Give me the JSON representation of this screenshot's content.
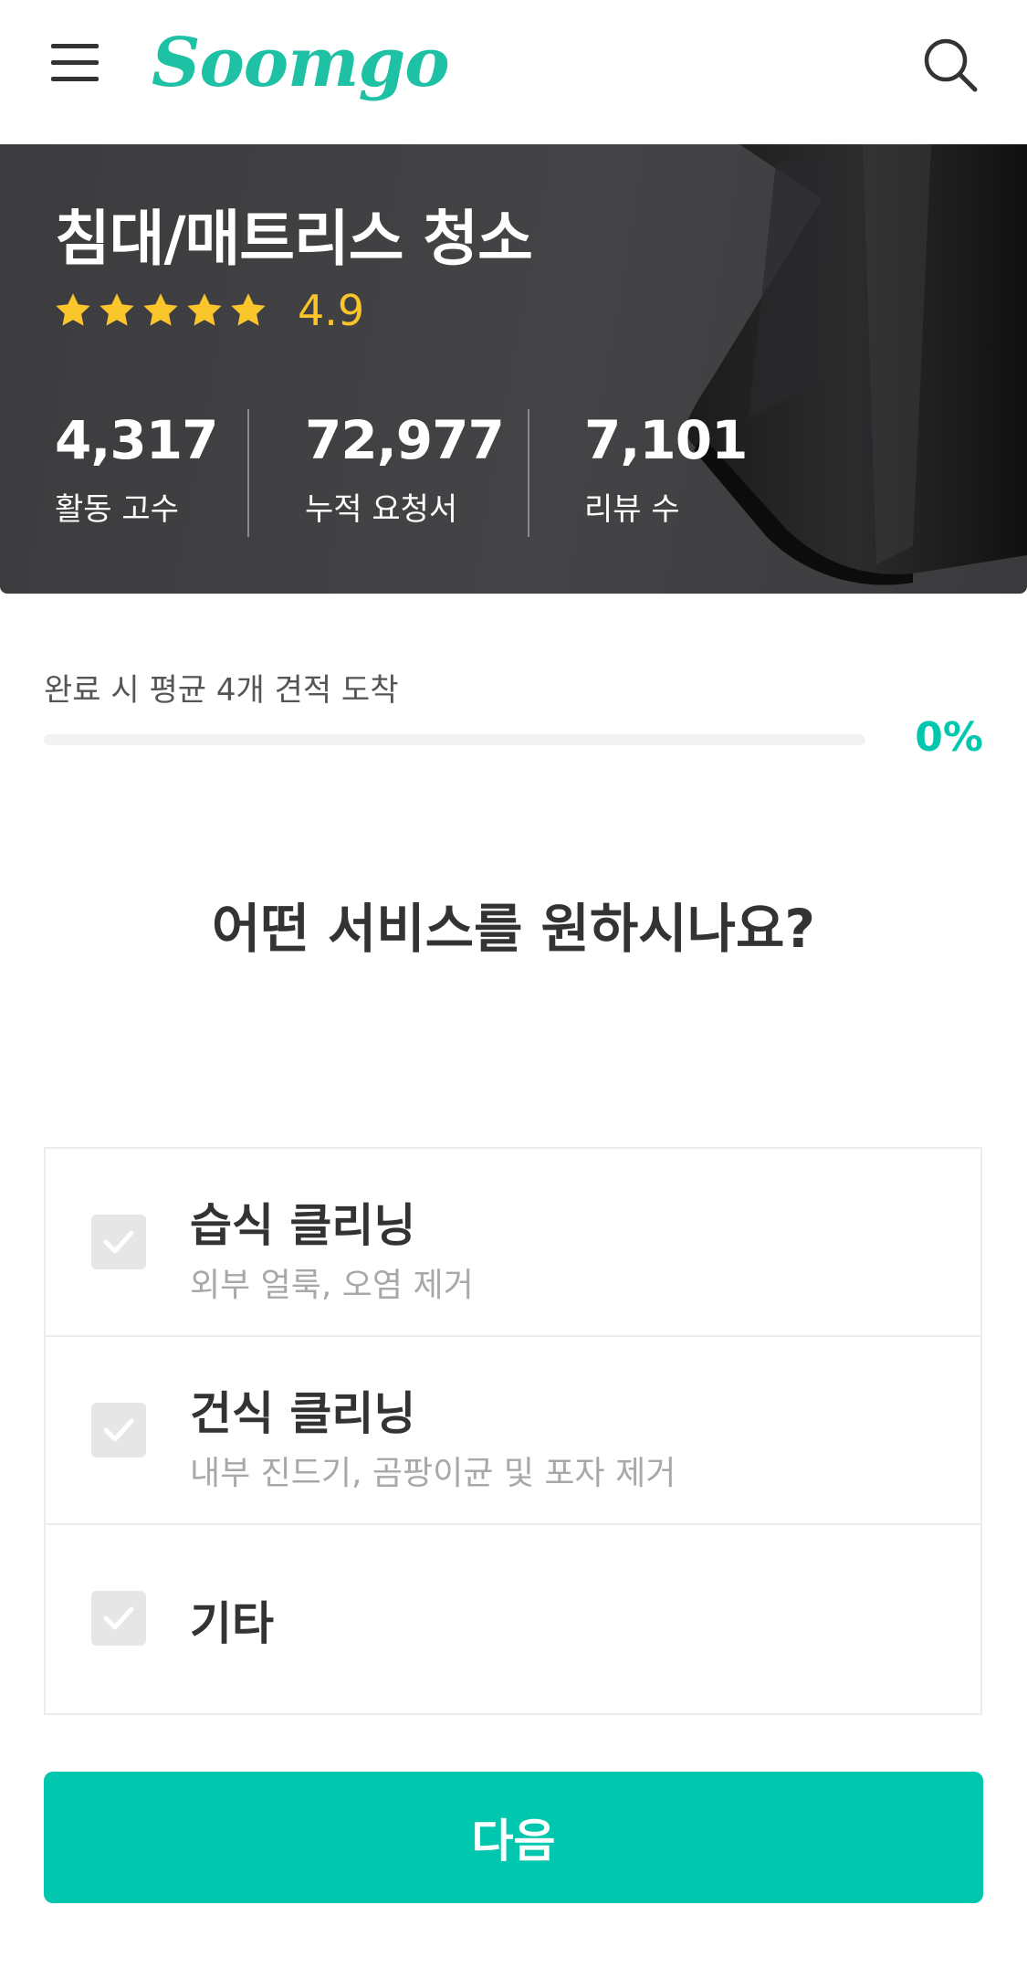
{
  "header": {
    "logo_text": "Soomgo",
    "menu_icon": "hamburger-menu-icon",
    "search_icon": "search-icon"
  },
  "hero": {
    "title": "침대/매트리스 청소",
    "rating_value": "4.9",
    "star_count": 5,
    "stats": [
      {
        "value": "4,317",
        "label": "활동 고수"
      },
      {
        "value": "72,977",
        "label": "누적 요청서"
      },
      {
        "value": "7,101",
        "label": "리뷰 수"
      }
    ]
  },
  "progress": {
    "caption": "완료 시 평균 4개 견적 도착",
    "percent_label": "0%",
    "percent": 0
  },
  "question": "어떤 서비스를 원하시나요?",
  "options": [
    {
      "title": "습식 클리닝",
      "subtitle": "외부 얼룩, 오염 제거",
      "checked": false
    },
    {
      "title": "건식 클리닝",
      "subtitle": "내부 진드기, 곰팡이균 및 포자 제거",
      "checked": false
    },
    {
      "title": "기타",
      "subtitle": "",
      "checked": false
    }
  ],
  "next_button": "다음",
  "colors": {
    "brand": "#1fc1a5",
    "accent": "#00c7ae",
    "star": "#f9c52a"
  }
}
